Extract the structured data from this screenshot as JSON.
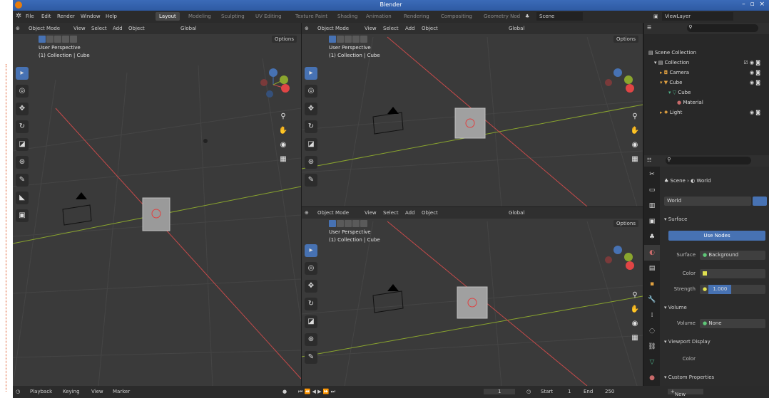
{
  "window": {
    "title": "Blender",
    "controls": "– ▫ ×"
  },
  "menu": [
    "File",
    "Edit",
    "Render",
    "Window",
    "Help"
  ],
  "workspaces": [
    "Layout",
    "Modeling",
    "Sculpting",
    "UV Editing",
    "Texture Paint",
    "Shading",
    "Animation",
    "Rendering",
    "Compositing",
    "Geometry Nod"
  ],
  "scene_label": "Scene",
  "viewlayer_label": "ViewLayer",
  "viewport": {
    "mode": "Object Mode",
    "menus": [
      "View",
      "Select",
      "Add",
      "Object"
    ],
    "transform": "Global",
    "options": "Options",
    "perspective": "User Perspective",
    "collection": "(1) Collection | Cube"
  },
  "outliner": {
    "title": "Scene Collection",
    "items": [
      "Collection",
      "Camera",
      "Cube",
      "Cube",
      "Material",
      "Light"
    ]
  },
  "properties": {
    "breadcrumb_scene": "Scene",
    "breadcrumb_world": "World",
    "world_name": "World",
    "surface": "Surface",
    "use_nodes": "Use Nodes",
    "surface_label": "Surface",
    "surface_value": "Background",
    "color_label": "Color",
    "strength_label": "Strength",
    "strength_value": "1.000",
    "volume": "Volume",
    "volume_label": "Volume",
    "volume_value": "None",
    "viewport_display": "Viewport Display",
    "vd_color": "Color",
    "custom_props": "Custom Properties",
    "new_button": "New"
  },
  "timeline": {
    "playback": "Playback",
    "keying": "Keying",
    "view": "View",
    "marker": "Marker",
    "current_frame": "1",
    "start_label": "Start",
    "start": "1",
    "end_label": "End",
    "end": "250"
  },
  "colors": {
    "accent": "#4772b3",
    "x_axis": "#c74a4a",
    "y_axis": "#8aa52e",
    "blender_orange": "#e87d0d"
  }
}
